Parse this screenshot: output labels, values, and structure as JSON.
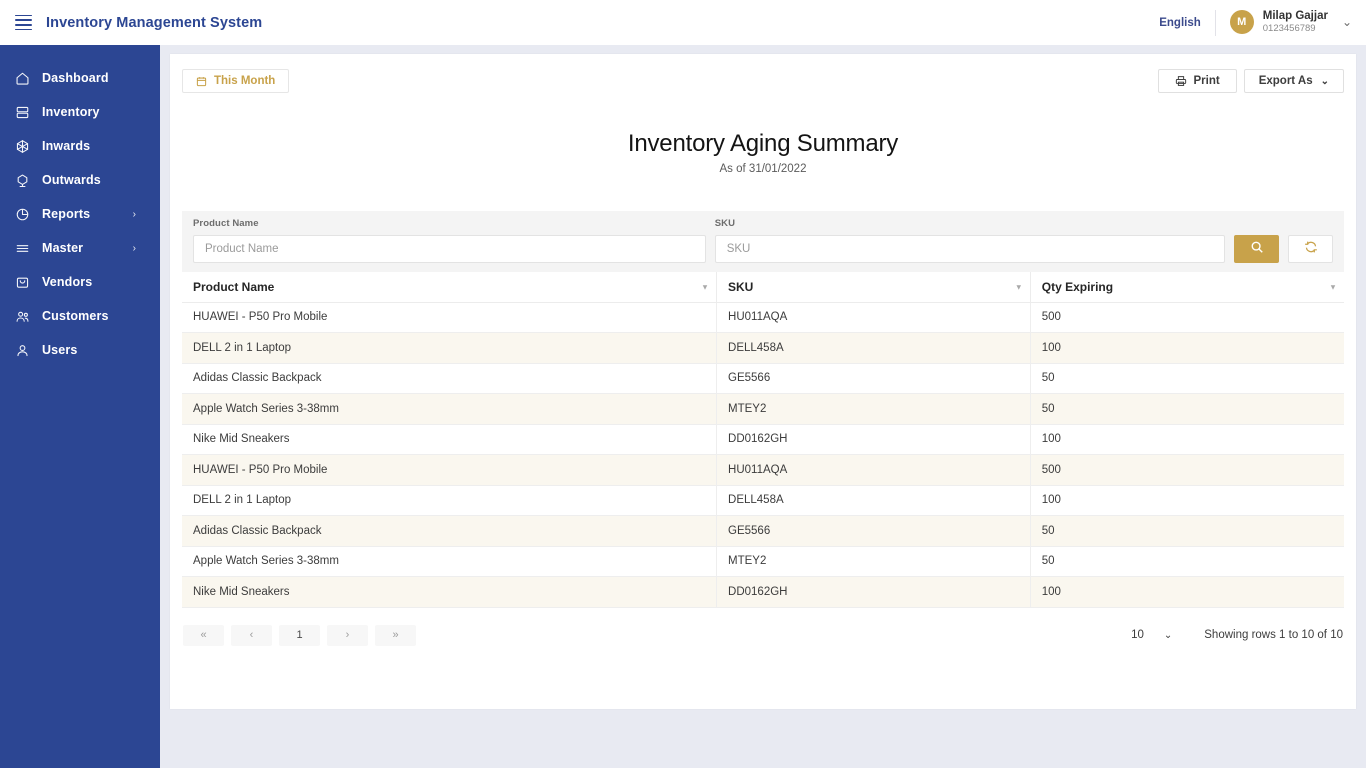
{
  "topbar": {
    "menu_icon": "hamburger-icon",
    "app_title": "Inventory Management System",
    "language": "English",
    "user": {
      "initial": "M",
      "name": "Milap Gajjar",
      "phone": "0123456789"
    },
    "caret": "⌄"
  },
  "sidebar": {
    "items": [
      {
        "label": "Dashboard",
        "icon": "home-icon",
        "arrow": ""
      },
      {
        "label": "Inventory",
        "icon": "database-icon",
        "arrow": ""
      },
      {
        "label": "Inwards",
        "icon": "inwards-box-icon",
        "arrow": ""
      },
      {
        "label": "Outwards",
        "icon": "outwards-box-icon",
        "arrow": ""
      },
      {
        "label": "Reports",
        "icon": "pie-clock-icon",
        "arrow": "›"
      },
      {
        "label": "Master",
        "icon": "list-icon",
        "arrow": "›"
      },
      {
        "label": "Vendors",
        "icon": "bag-icon",
        "arrow": ""
      },
      {
        "label": "Customers",
        "icon": "users-icon",
        "arrow": ""
      },
      {
        "label": "Users",
        "icon": "user-icon",
        "arrow": ""
      }
    ]
  },
  "toolbar": {
    "date_range_label": "This Month",
    "date_range_icon": "calendar-icon",
    "print_label": "Print",
    "print_icon": "printer-icon",
    "export_label": "Export As",
    "export_caret": "⌄"
  },
  "report": {
    "title": "Inventory Aging Summary",
    "subtitle": "As of 31/01/2022"
  },
  "filters": {
    "product_name": {
      "label": "Product Name",
      "placeholder": "Product Name",
      "value": ""
    },
    "sku": {
      "label": "SKU",
      "placeholder": "SKU",
      "value": ""
    },
    "search_icon": "search-icon",
    "refresh_icon": "refresh-icon"
  },
  "table": {
    "columns": [
      "Product Name",
      "SKU",
      "Qty Expiring"
    ],
    "header_caret": "▾",
    "rows": [
      [
        "HUAWEI - P50 Pro Mobile",
        "HU011AQA",
        "500"
      ],
      [
        "DELL 2 in 1 Laptop",
        "DELL458A",
        "100"
      ],
      [
        "Adidas Classic Backpack",
        "GE5566",
        "50"
      ],
      [
        "Apple Watch Series 3-38mm",
        "MTEY2",
        "50"
      ],
      [
        "Nike Mid Sneakers",
        "DD0162GH",
        "100"
      ],
      [
        "HUAWEI - P50 Pro Mobile",
        "HU011AQA",
        "500"
      ],
      [
        "DELL 2 in 1 Laptop",
        "DELL458A",
        "100"
      ],
      [
        "Adidas Classic Backpack",
        "GE5566",
        "50"
      ],
      [
        "Apple Watch Series 3-38mm",
        "MTEY2",
        "50"
      ],
      [
        "Nike Mid Sneakers",
        "DD0162GH",
        "100"
      ]
    ]
  },
  "pagination": {
    "first": "«",
    "prev": "‹",
    "pages": [
      "1"
    ],
    "next": "›",
    "last": "»",
    "page_size": "10",
    "page_size_caret": "⌄",
    "showing": "Showing rows 1 to 10 of 10"
  },
  "colors": {
    "sidebar": "#2c4693",
    "accent_gold": "#c8a24a",
    "page_bg": "#e8eaf2",
    "row_alt": "#faf7ef"
  }
}
